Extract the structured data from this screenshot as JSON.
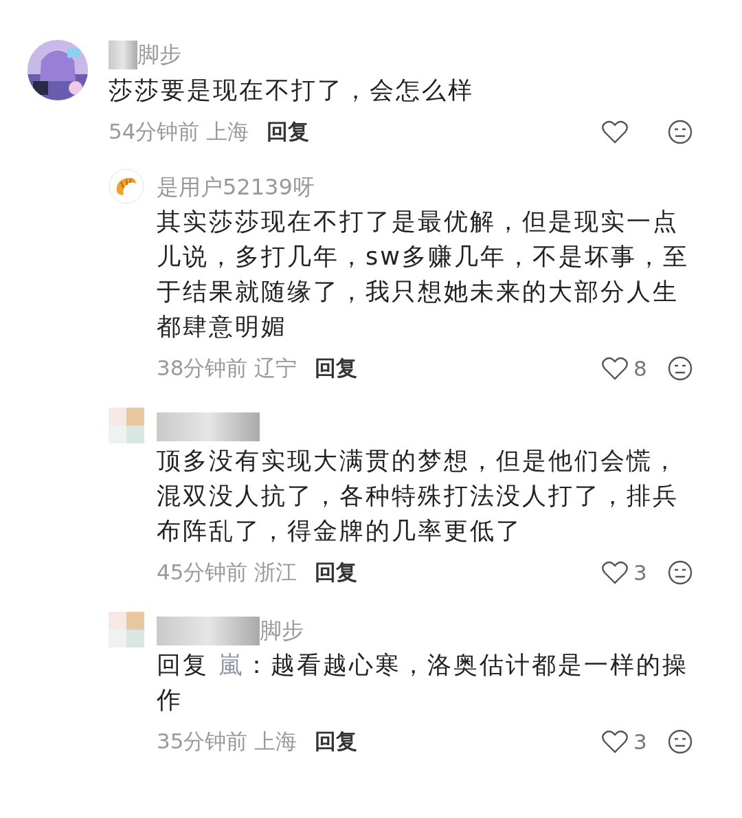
{
  "comments": [
    {
      "kind": "top",
      "redacted": true,
      "author": "脚步",
      "text": "莎莎要是现在不打了，会怎么样",
      "time": "54分钟前",
      "location": "上海",
      "reply_label": "回复"
    },
    {
      "kind": "reply",
      "avatar": {
        "kind": "croissant"
      },
      "redacted": false,
      "author": "是用户52139呀",
      "text": "其实莎莎现在不打了是最优解，但是现实一点儿说，多打几年，sw多赚几年，不是坏事，至于结果就随缘了，我只想她未来的大部分人生都肆意明媚",
      "time": "38分钟前",
      "location": "辽宁",
      "reply_label": "回复",
      "likes": "8"
    },
    {
      "kind": "reply",
      "avatar": {
        "kind": "blurred"
      },
      "redacted": true,
      "text": "顶多没有实现大满贯的梦想，但是他们会慌，混双没人抗了，各种特殊打法没人打了，排兵布阵乱了，得金牌的几率更低了",
      "time": "45分钟前",
      "location": "浙江",
      "reply_label": "回复",
      "likes": "3"
    },
    {
      "kind": "reply",
      "avatar": {
        "kind": "blurred"
      },
      "redacted": true,
      "author": "脚步",
      "reply_prefix": "回复",
      "reply_to": "嵐",
      "text": "：越看越心寒，洛奥估计都是一样的操作",
      "time": "35分钟前",
      "location": "上海",
      "reply_label": "回复",
      "likes": "3"
    }
  ]
}
